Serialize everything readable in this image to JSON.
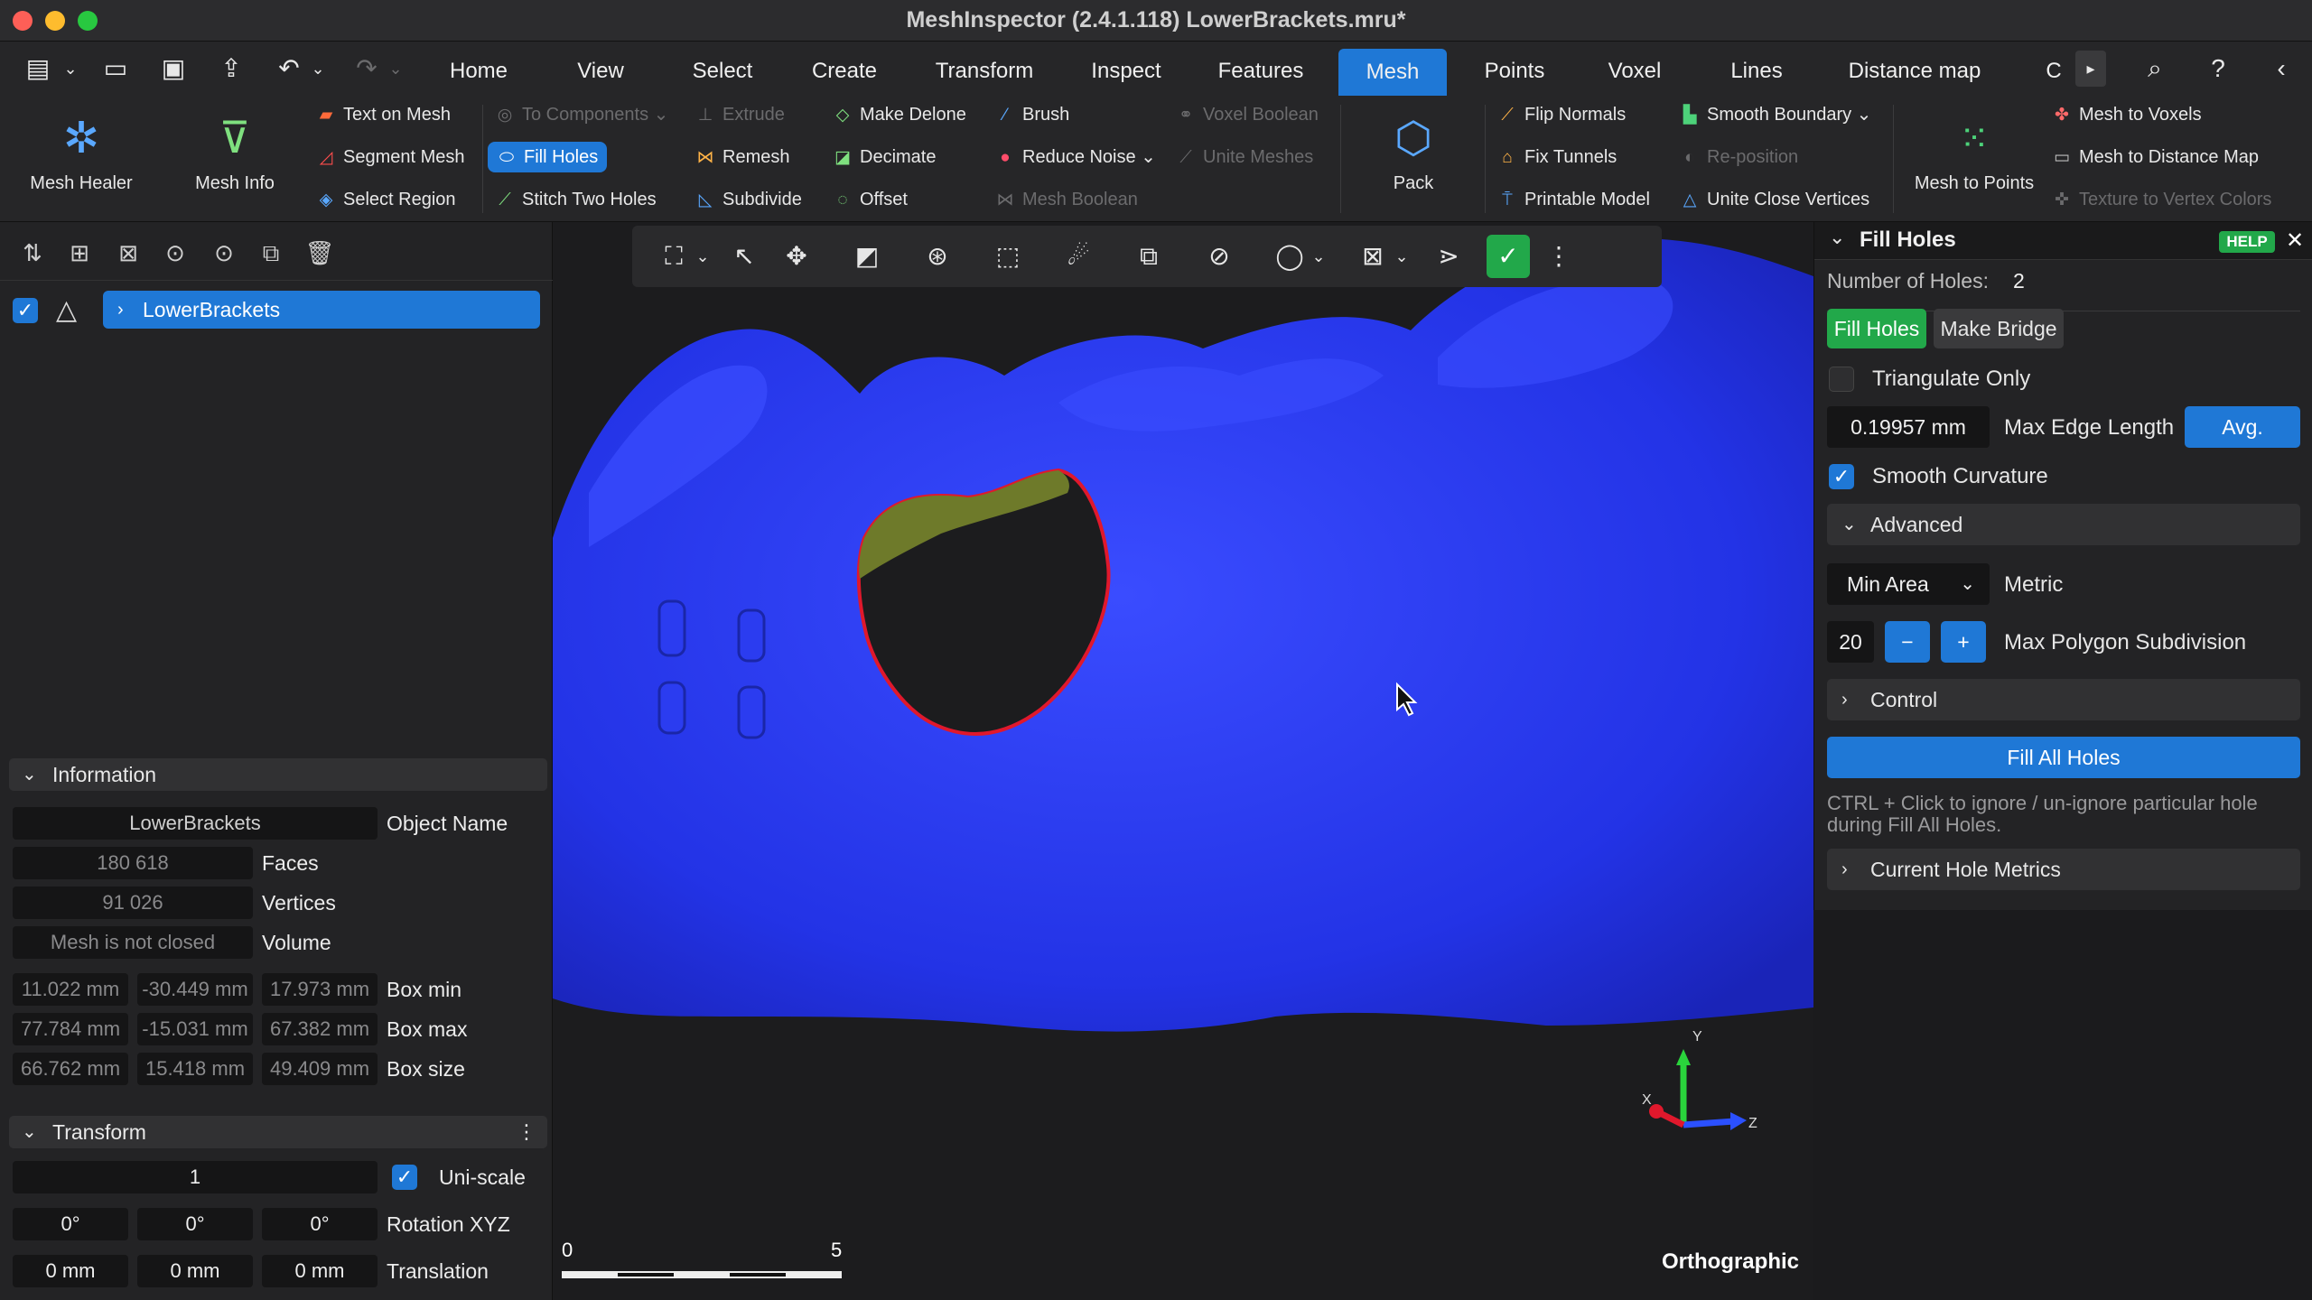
{
  "window": {
    "title": "MeshInspector (2.4.1.118) LowerBrackets.mru*"
  },
  "menu": {
    "items": [
      "Home",
      "View",
      "Select",
      "Create",
      "Transform",
      "Inspect",
      "Features",
      "Mesh",
      "Points",
      "Voxel",
      "Lines",
      "Distance map",
      "C"
    ],
    "active": "Mesh"
  },
  "ribbon": {
    "mesh_healer": "Mesh Healer",
    "mesh_info": "Mesh Info",
    "text_on_mesh": "Text on Mesh",
    "segment_mesh": "Segment Mesh",
    "select_region": "Select Region",
    "to_components": "To Components",
    "fill_holes": "Fill Holes",
    "stitch_two_holes": "Stitch Two Holes",
    "extrude": "Extrude",
    "remesh": "Remesh",
    "subdivide": "Subdivide",
    "make_delone": "Make Delone",
    "decimate": "Decimate",
    "offset": "Offset",
    "brush": "Brush",
    "reduce_noise": "Reduce Noise",
    "mesh_boolean": "Mesh Boolean",
    "voxel_boolean": "Voxel Boolean",
    "unite_meshes": "Unite Meshes",
    "pack": "Pack",
    "flip_normals": "Flip Normals",
    "fix_tunnels": "Fix Tunnels",
    "printable_model": "Printable Model",
    "smooth_boundary": "Smooth Boundary",
    "reposition": "Re-position",
    "unite_close_vertices": "Unite Close Vertices",
    "mesh_to_points": "Mesh to Points",
    "mesh_to_voxels": "Mesh to Voxels",
    "mesh_to_distance_map": "Mesh to Distance Map",
    "texture_to_vertex_colors": "Texture to Vertex Colors"
  },
  "scene": {
    "object_name": "LowerBrackets"
  },
  "information": {
    "header": "Information",
    "name_value": "LowerBrackets",
    "name_label": "Object Name",
    "faces_value": "180 618",
    "faces_label": "Faces",
    "vertices_value": "91 026",
    "vertices_label": "Vertices",
    "volume_value": "Mesh is not closed",
    "volume_label": "Volume",
    "box_min": [
      "11.022 mm",
      "-30.449 mm",
      "17.973 mm"
    ],
    "box_min_label": "Box min",
    "box_max": [
      "77.784 mm",
      "-15.031 mm",
      "67.382 mm"
    ],
    "box_max_label": "Box max",
    "box_size": [
      "66.762 mm",
      "15.418 mm",
      "49.409 mm"
    ],
    "box_size_label": "Box size"
  },
  "transform": {
    "header": "Transform",
    "scale_value": "1",
    "uniscale_label": "Uni-scale",
    "rotation": [
      "0°",
      "0°",
      "0°"
    ],
    "rotation_label": "Rotation XYZ",
    "translation": [
      "0 mm",
      "0 mm",
      "0 mm"
    ],
    "translation_label": "Translation"
  },
  "viewport": {
    "scale_min": "0",
    "scale_max": "5",
    "projection": "Orthographic",
    "axis_x": "X",
    "axis_y": "Y",
    "axis_z": "Z"
  },
  "fill_holes_panel": {
    "title": "Fill Holes",
    "help": "HELP",
    "num_holes_label": "Number of Holes:",
    "num_holes_value": "2",
    "tab_fill": "Fill Holes",
    "tab_bridge": "Make Bridge",
    "triangulate_only": "Triangulate Only",
    "edge_length_value": "0.19957 mm",
    "edge_length_label": "Max Edge Length",
    "avg_button": "Avg.",
    "smooth_curvature": "Smooth Curvature",
    "advanced": "Advanced",
    "metric_value": "Min Area",
    "metric_label": "Metric",
    "subdivision_value": "20",
    "subdivision_minus": "−",
    "subdivision_plus": "+",
    "subdivision_label": "Max Polygon Subdivision",
    "control": "Control",
    "fill_all_button": "Fill All Holes",
    "hint": "CTRL + Click to ignore / un-ignore particular hole during Fill All Holes.",
    "current_metrics": "Current Hole Metrics"
  },
  "colors": {
    "accent": "#1f78d6",
    "active_green": "#22a84a",
    "mesh_blue": "#2f3ff5",
    "hole_outline": "#e0182c",
    "patch": "#6e7a2a"
  }
}
